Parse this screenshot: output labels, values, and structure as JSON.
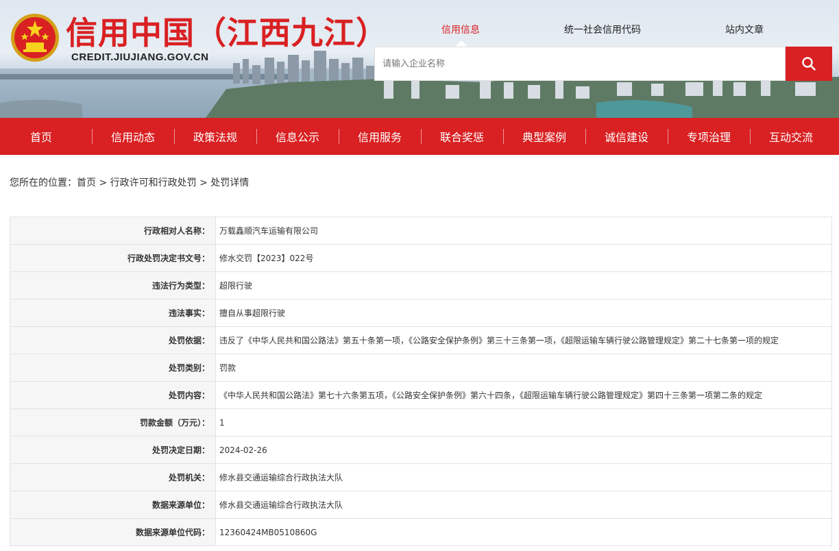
{
  "header": {
    "site_title": "信用中国（江西九江）",
    "site_domain": "CREDIT.JIUJIANG.GOV.CN",
    "emblem_icon": "national-emblem-icon",
    "tabs": [
      {
        "label": "信用信息",
        "active": true
      },
      {
        "label": "统一社会信用代码",
        "active": false
      },
      {
        "label": "站内文章",
        "active": false
      }
    ],
    "search": {
      "placeholder": "请输入企业名称",
      "icon": "search-icon"
    },
    "accent_color": "#d92022"
  },
  "nav": {
    "items": [
      "首页",
      "信用动态",
      "政策法规",
      "信息公示",
      "信用服务",
      "联合奖惩",
      "典型案例",
      "诚信建设",
      "专项治理",
      "互动交流"
    ]
  },
  "breadcrumb": {
    "prefix": "您所在的位置：",
    "items": [
      "首页",
      "行政许可和行政处罚",
      "处罚详情"
    ],
    "separator": " > "
  },
  "detail": {
    "rows": [
      {
        "label": "行政相对人名称：",
        "value": "万载鑫顺汽车运输有限公司"
      },
      {
        "label": "行政处罚决定书文号：",
        "value": "修水交罚【2023】022号"
      },
      {
        "label": "违法行为类型：",
        "value": "超限行驶"
      },
      {
        "label": "违法事实：",
        "value": "擅自从事超限行驶"
      },
      {
        "label": "处罚依据：",
        "value": "违反了《中华人民共和国公路法》第五十条第一项，《公路安全保护条例》第三十三条第一项，《超限运输车辆行驶公路管理规定》第二十七条第一项的规定"
      },
      {
        "label": "处罚类别：",
        "value": "罚款"
      },
      {
        "label": "处罚内容：",
        "value": "《中华人民共和国公路法》第七十六条第五项，《公路安全保护条例》第六十四条，《超限运输车辆行驶公路管理规定》第四十三条第一项第二条的规定"
      },
      {
        "label": "罚款金额（万元）：",
        "value": "1"
      },
      {
        "label": "处罚决定日期：",
        "value": "2024-02-26"
      },
      {
        "label": "处罚机关：",
        "value": "修水县交通运输综合行政执法大队"
      },
      {
        "label": "数据来源单位：",
        "value": "修水县交通运输综合行政执法大队"
      },
      {
        "label": "数据来源单位代码：",
        "value": "12360424MB0510860G"
      }
    ]
  }
}
